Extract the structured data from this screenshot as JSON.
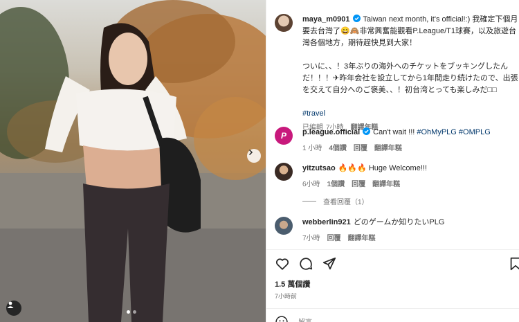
{
  "post": {
    "author": "maya_m0901",
    "caption_en": "Taiwan next month, it's official!:)",
    "caption_zh_1": "我確定下個月要去台灣了😄🙈非常興奮能觀看P.League/T1球賽，以及旅遊台灣各個地方，期待趕快見到大家！",
    "caption_ja": "ついに、、！3年ぶりの海外へのチケットをブッキングしたんだ！！！✈昨年会社を設立してから1年間走り続けたので、出張を交えて自分へのご褒美、、！初台湾とっても楽しみだ□□",
    "hashtag": "#travel",
    "edited": "已編輯",
    "time": "7小時",
    "translate": "翻譯年糕"
  },
  "comments": [
    {
      "user": "p.league.official",
      "text": "Can't wait !!! ",
      "tags": "#OhMyPLG #OMPLG",
      "time": "1 小時",
      "likes": "4個讚",
      "reply": "回覆",
      "translate": "翻譯年糕",
      "verified": true
    },
    {
      "user": "yitzutsao",
      "text": "🔥🔥🔥 Huge Welcome!!!",
      "time": "6小時",
      "likes": "1個讚",
      "reply": "回覆",
      "translate": "翻譯年糕"
    },
    {
      "user": "webberlin921",
      "text": "どのゲームか知りたいPLG",
      "time": "7小時",
      "reply": "回覆",
      "translate": "翻譯年糕"
    }
  ],
  "view_replies": "查看回覆（1）",
  "likes_count": "1.5 萬個讚",
  "posted_time": "7小時前",
  "add_comment_placeholder": "留言……",
  "icons": {
    "like": "heart-icon",
    "comment": "comment-icon",
    "share": "paper-plane-icon",
    "save": "bookmark-icon",
    "emoji": "emoji-icon",
    "next": "chevron-right-icon",
    "tag": "user-tag-icon",
    "verified": "verified-badge-icon"
  },
  "colors": {
    "hashtag": "#00376b",
    "verified": "#0095f6",
    "muted": "#737373"
  }
}
